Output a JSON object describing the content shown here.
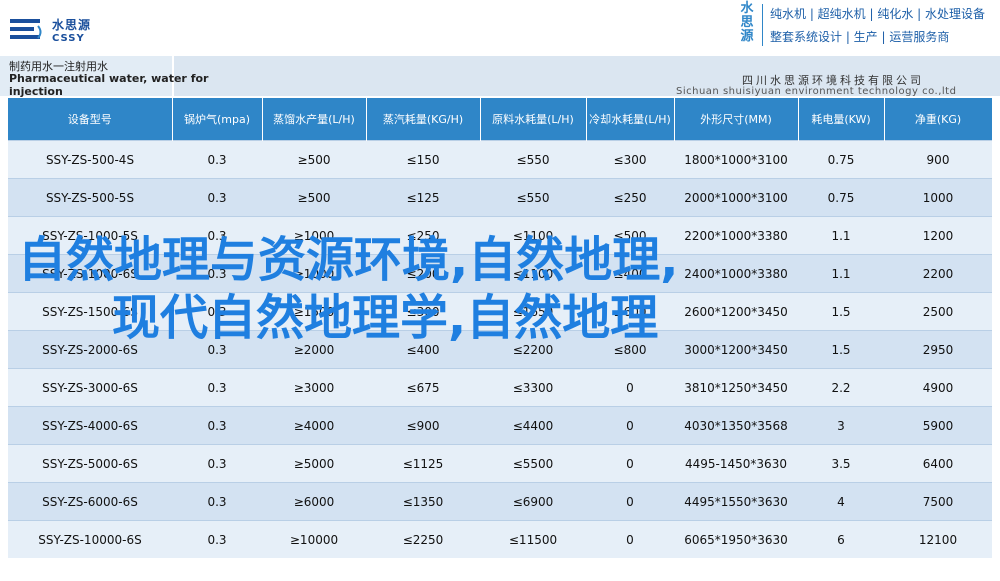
{
  "logo": {
    "name_cn": "水思源",
    "name_en": "CSSY"
  },
  "brand": {
    "vertical": [
      "水",
      "思",
      "源"
    ],
    "line1": "纯水机 | 超纯水机 | 纯化水 | 水处理设备",
    "line2": "整套系统设计 | 生产 | 运营服务商"
  },
  "title": {
    "cn": "制药用水一注射用水",
    "en_line1": "Pharmaceutical water, water for",
    "en_line2": "injection"
  },
  "company": {
    "cn": "四川水思源环境科技有限公司",
    "en": "Sichuan shuisiyuan environment technology co.,ltd"
  },
  "table": {
    "headers": [
      "设备型号",
      "锅炉气(mpa)",
      "蒸馏水产量(L/H)",
      "蒸汽耗量(KG/H)",
      "原料水耗量(L/H)",
      "冷却水耗量(L/H)",
      "外形尺寸(MM)",
      "耗电量(KW)",
      "净重(KG)"
    ],
    "rows": [
      [
        "SSY-ZS-500-4S",
        "0.3",
        "≥500",
        "≤150",
        "≤550",
        "≤300",
        "1800*1000*3100",
        "0.75",
        "900"
      ],
      [
        "SSY-ZS-500-5S",
        "0.3",
        "≥500",
        "≤125",
        "≤550",
        "≤250",
        "2000*1000*3100",
        "0.75",
        "1000"
      ],
      [
        "SSY-ZS-1000-5S",
        "0.3",
        "≥1000",
        "≤250",
        "≤1100",
        "≤500",
        "2200*1000*3380",
        "1.1",
        "1200"
      ],
      [
        "SSY-ZS-1000-6S",
        "0.3",
        "≥1000",
        "≤200",
        "≤1100",
        "≤400",
        "2400*1000*3380",
        "1.1",
        "2200"
      ],
      [
        "SSY-ZS-1500-6S",
        "0.3",
        "≥1500",
        "≤300",
        "≤1650",
        "≤600",
        "2600*1200*3450",
        "1.5",
        "2500"
      ],
      [
        "SSY-ZS-2000-6S",
        "0.3",
        "≥2000",
        "≤400",
        "≤2200",
        "≤800",
        "3000*1200*3450",
        "1.5",
        "2950"
      ],
      [
        "SSY-ZS-3000-6S",
        "0.3",
        "≥3000",
        "≤675",
        "≤3300",
        "0",
        "3810*1250*3450",
        "2.2",
        "4900"
      ],
      [
        "SSY-ZS-4000-6S",
        "0.3",
        "≥4000",
        "≤900",
        "≤4400",
        "0",
        "4030*1350*3568",
        "3",
        "5900"
      ],
      [
        "SSY-ZS-5000-6S",
        "0.3",
        "≥5000",
        "≤1125",
        "≤5500",
        "0",
        "4495-1450*3630",
        "3.5",
        "6400"
      ],
      [
        "SSY-ZS-6000-6S",
        "0.3",
        "≥6000",
        "≤1350",
        "≤6900",
        "0",
        "4495*1550*3630",
        "4",
        "7500"
      ],
      [
        "SSY-ZS-10000-6S",
        "0.3",
        "≥10000",
        "≤2250",
        "≤11500",
        "0",
        "6065*1950*3630",
        "6",
        "12100"
      ]
    ]
  },
  "overlay": {
    "line1": "自然地理与资源环境,自然地理,",
    "line2": "现代自然地理学,自然地理"
  },
  "colors": {
    "header_blue": "#2f86c8",
    "overlay_blue": "#1f7fe0",
    "row_light": "#e6eff8",
    "row_dark": "#d3e2f2"
  }
}
